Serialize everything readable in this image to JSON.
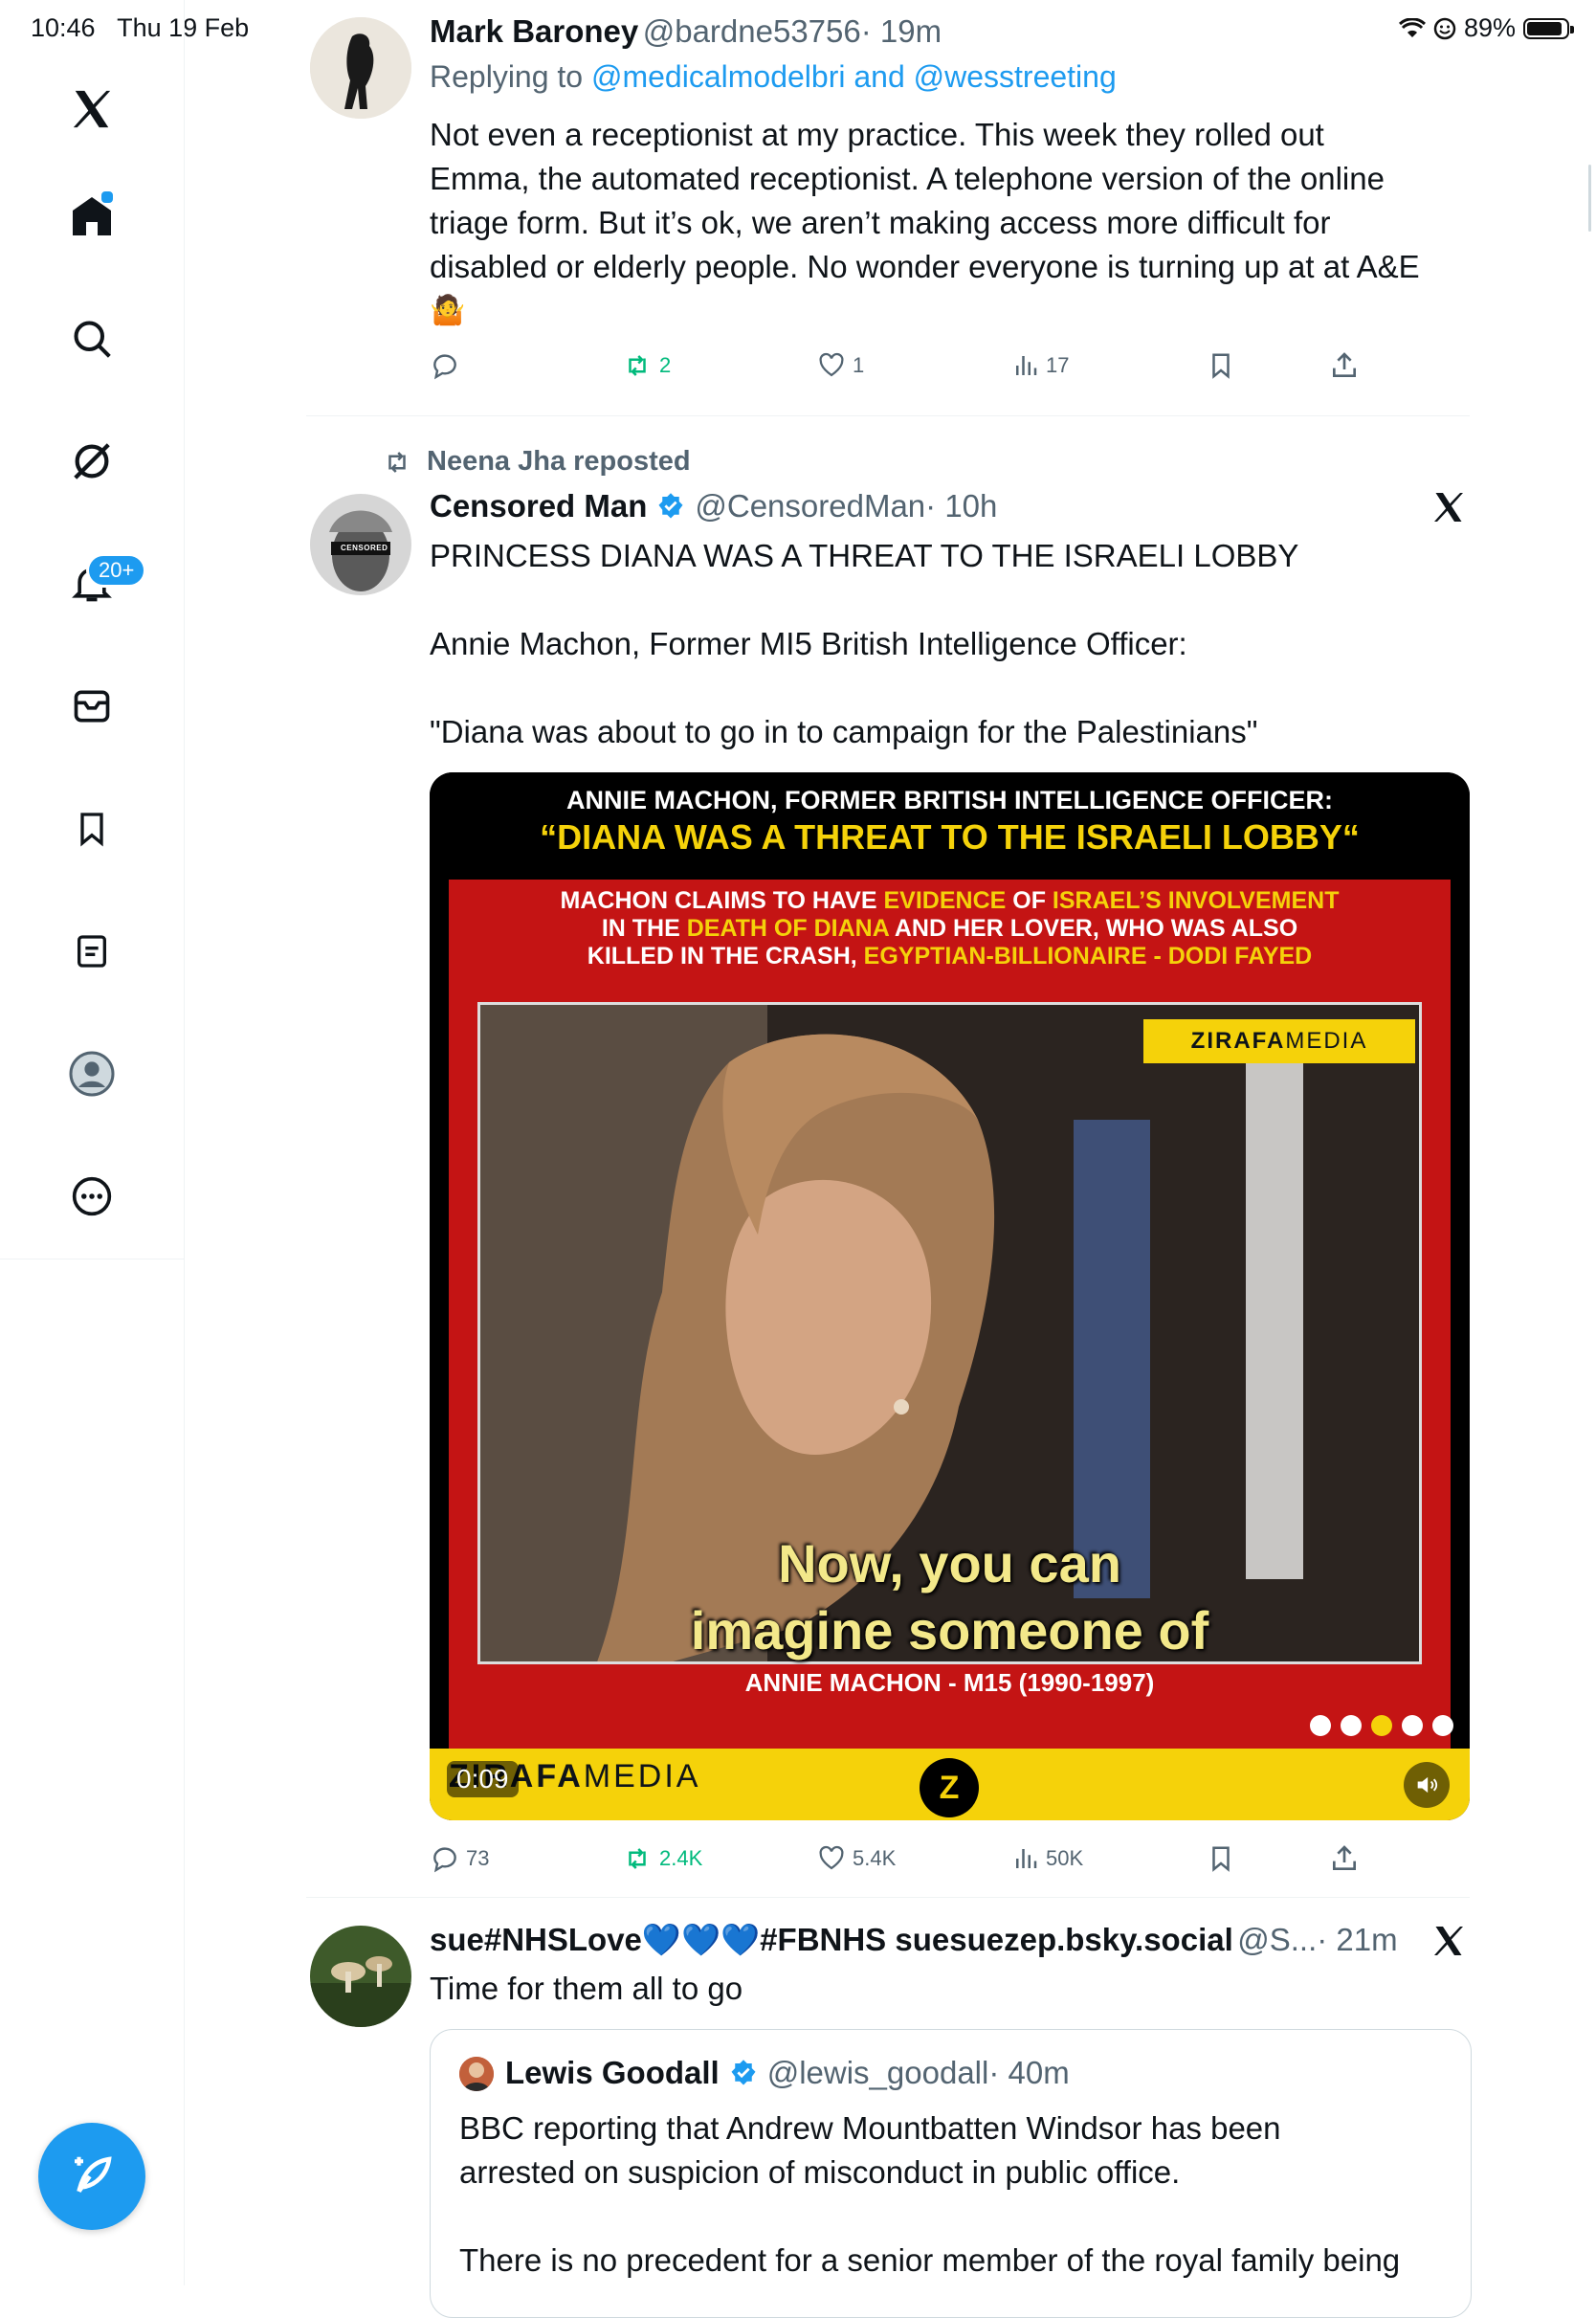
{
  "status_bar": {
    "time": "10:46",
    "date": "Thu 19 Feb",
    "battery": "89%",
    "battery_level": 0.89
  },
  "sidebar": {
    "notifications_badge": "20+",
    "items": [
      {
        "name": "x-logo-icon"
      },
      {
        "name": "home-icon"
      },
      {
        "name": "search-icon"
      },
      {
        "name": "grok-icon"
      },
      {
        "name": "notifications-icon"
      },
      {
        "name": "messages-icon"
      },
      {
        "name": "bookmarks-icon"
      },
      {
        "name": "lists-icon"
      },
      {
        "name": "profile-icon"
      },
      {
        "name": "more-icon"
      }
    ]
  },
  "colors": {
    "accent": "#1d9bf0",
    "retweet_green": "#00ba7c",
    "text": "#0f1419",
    "muted": "#536471"
  },
  "tweets": [
    {
      "name": "Mark Baroney",
      "handle": "@bardne53756",
      "time": "· 19m",
      "replying_prefix": "Replying to ",
      "replying_to": "@medicalmodelbri and @wesstreeting",
      "text_lines": [
        "Not even a receptionist at my practice.  This week they rolled out",
        "Emma, the automated receptionist.  A telephone version of the online",
        "triage form.  But it’s ok, we aren’t making access more difficult for",
        "disabled or elderly people.  No wonder everyone is turning up at at A&E"
      ],
      "emoji": "🤷",
      "stats": {
        "replies": "",
        "reposts": "2",
        "likes": "1",
        "views": "17"
      }
    },
    {
      "repost_label": "Neena Jha reposted",
      "name": "Censored Man",
      "handle": "@CensoredMan",
      "time": "· 10h",
      "avatar_text": "CENSORED",
      "text_lines": [
        "PRINCESS DIANA WAS A THREAT TO THE ISRAELI LOBBY",
        "",
        "Annie Machon, Former MI5 British Intelligence Officer:",
        "",
        "\"Diana was about to go in to campaign for the Palestinians\""
      ],
      "media": {
        "headline1": "ANNIE MACHON, FORMER BRITISH INTELLIGENCE OFFICER:",
        "headline2": "“DIANA WAS A THREAT TO THE ISRAELI LOBBY“",
        "red_line1_a": "MACHON CLAIMS TO HAVE ",
        "red_line1_b": "EVIDENCE",
        "red_line1_c": " OF ",
        "red_line1_d": "ISRAEL’S INVOLVEMENT",
        "red_line2_a": "IN THE ",
        "red_line2_b": "DEATH OF DIANA",
        "red_line2_c": " AND HER LOVER, WHO WAS ALSO",
        "red_line3_a": "KILLED IN THE CRASH, ",
        "red_line3_b": "EGYPTIAN-BILLIONAIRE - DODI FAYED",
        "watermark_a": "ZIRAFA",
        "watermark_b": "MEDIA",
        "caption1": "Now, you can",
        "caption2": "imagine someone of",
        "lower_third": "ANNIE MACHON - M15 (1990-1997)",
        "time_code": "0:09",
        "footer_a": "ZIRAFA",
        "footer_b": "MEDIA",
        "logo_letter": "Z"
      },
      "stats": {
        "replies": "73",
        "reposts": "2.4K",
        "likes": "5.4K",
        "views": "50K"
      }
    },
    {
      "name": "sue#NHSLove💙💙💙#FBNHS suesuezep.bsky.social",
      "handle": "@S...",
      "time": "· 21m",
      "text_lines": [
        "Time for them all to go"
      ],
      "quote": {
        "name": "Lewis Goodall",
        "handle": "@lewis_goodall",
        "time": "· 40m",
        "text_lines": [
          "BBC reporting that Andrew Mountbatten Windsor has been",
          "arrested on suspicion of misconduct in public office.",
          "",
          "There is no precedent for a senior member of the royal family being"
        ]
      }
    }
  ]
}
